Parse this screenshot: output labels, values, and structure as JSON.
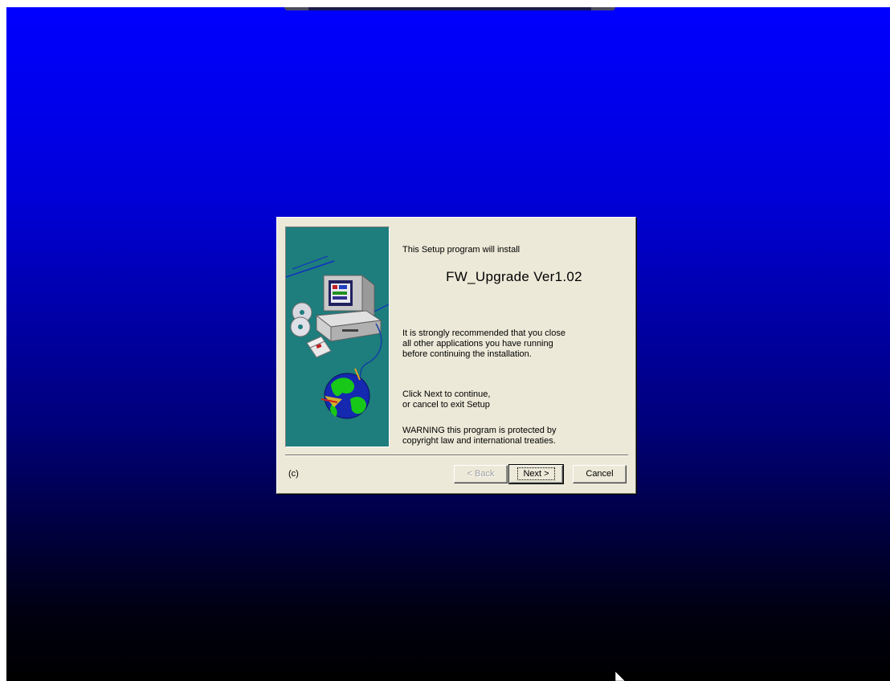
{
  "dialog": {
    "intro": "This Setup program will install",
    "product_title": "FW_Upgrade Ver1.02",
    "recommendation": "It is strongly recommended that you close\nall other applications you have running\nbefore continuing the installation.",
    "continue_instructions": "Click Next to continue,\nor cancel to exit Setup",
    "warning": "WARNING this program is protected by\ncopyright law and international treaties.",
    "copyright_label": "(c)",
    "buttons": {
      "back": "< Back",
      "next": "Next >",
      "cancel": "Cancel"
    },
    "back_enabled": false,
    "side_panel_color": "#1e7d7d"
  },
  "desktop": {
    "gradient_top": "#0000ff",
    "gradient_bottom": "#000000"
  },
  "icons": {
    "illustration": "computer-cd-globe-illustration",
    "cursor": "mouse-pointer-icon"
  }
}
